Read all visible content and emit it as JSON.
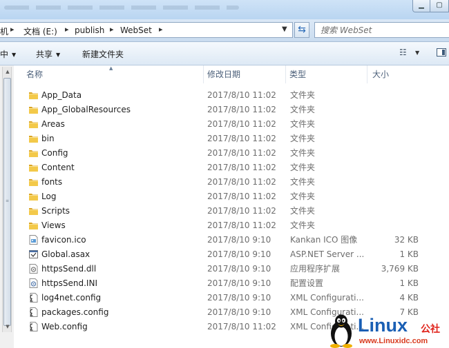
{
  "address": {
    "crumbs": [
      "机",
      "文档 (E:)",
      "publish",
      "WebSet"
    ],
    "search_placeholder": "搜索 WebSet"
  },
  "toolbar": {
    "left_label": "中",
    "share_label": "共享",
    "new_folder_label": "新建文件夹"
  },
  "columns": {
    "name": "名称",
    "date": "修改日期",
    "type": "类型",
    "size": "大小"
  },
  "files": [
    {
      "name": "App_Data",
      "date": "2017/8/10 11:02",
      "type": "文件夹",
      "size": "",
      "icon": "folder-icon"
    },
    {
      "name": "App_GlobalResources",
      "date": "2017/8/10 11:02",
      "type": "文件夹",
      "size": "",
      "icon": "folder-icon"
    },
    {
      "name": "Areas",
      "date": "2017/8/10 11:02",
      "type": "文件夹",
      "size": "",
      "icon": "folder-icon"
    },
    {
      "name": "bin",
      "date": "2017/8/10 11:02",
      "type": "文件夹",
      "size": "",
      "icon": "folder-icon"
    },
    {
      "name": "Config",
      "date": "2017/8/10 11:02",
      "type": "文件夹",
      "size": "",
      "icon": "folder-icon"
    },
    {
      "name": "Content",
      "date": "2017/8/10 11:02",
      "type": "文件夹",
      "size": "",
      "icon": "folder-icon"
    },
    {
      "name": "fonts",
      "date": "2017/8/10 11:02",
      "type": "文件夹",
      "size": "",
      "icon": "folder-icon"
    },
    {
      "name": "Log",
      "date": "2017/8/10 11:02",
      "type": "文件夹",
      "size": "",
      "icon": "folder-icon"
    },
    {
      "name": "Scripts",
      "date": "2017/8/10 11:02",
      "type": "文件夹",
      "size": "",
      "icon": "folder-icon"
    },
    {
      "name": "Views",
      "date": "2017/8/10 11:02",
      "type": "文件夹",
      "size": "",
      "icon": "folder-icon"
    },
    {
      "name": "favicon.ico",
      "date": "2017/8/10 9:10",
      "type": "Kankan ICO 图像",
      "size": "32 KB",
      "icon": "image-file-icon"
    },
    {
      "name": "Global.asax",
      "date": "2017/8/10 9:10",
      "type": "ASP.NET Server ...",
      "size": "1 KB",
      "icon": "aspnet-file-icon"
    },
    {
      "name": "httpsSend.dll",
      "date": "2017/8/10 9:10",
      "type": "应用程序扩展",
      "size": "3,769 KB",
      "icon": "dll-file-icon"
    },
    {
      "name": "httpsSend.INI",
      "date": "2017/8/10 9:10",
      "type": "配置设置",
      "size": "1 KB",
      "icon": "ini-file-icon"
    },
    {
      "name": "log4net.config",
      "date": "2017/8/10 9:10",
      "type": "XML Configurati...",
      "size": "4 KB",
      "icon": "config-file-icon"
    },
    {
      "name": "packages.config",
      "date": "2017/8/10 9:10",
      "type": "XML Configurati...",
      "size": "7 KB",
      "icon": "config-file-icon"
    },
    {
      "name": "Web.config",
      "date": "2017/8/10 11:02",
      "type": "XML Configurati...",
      "size": "",
      "icon": "config-file-icon"
    }
  ],
  "watermark": {
    "logo_text": "Linux",
    "logo_cn": "公社",
    "url": "www.Linuxidc.com"
  },
  "colors": {
    "folder": "#e8b730",
    "accent": "#1a5fb4"
  }
}
